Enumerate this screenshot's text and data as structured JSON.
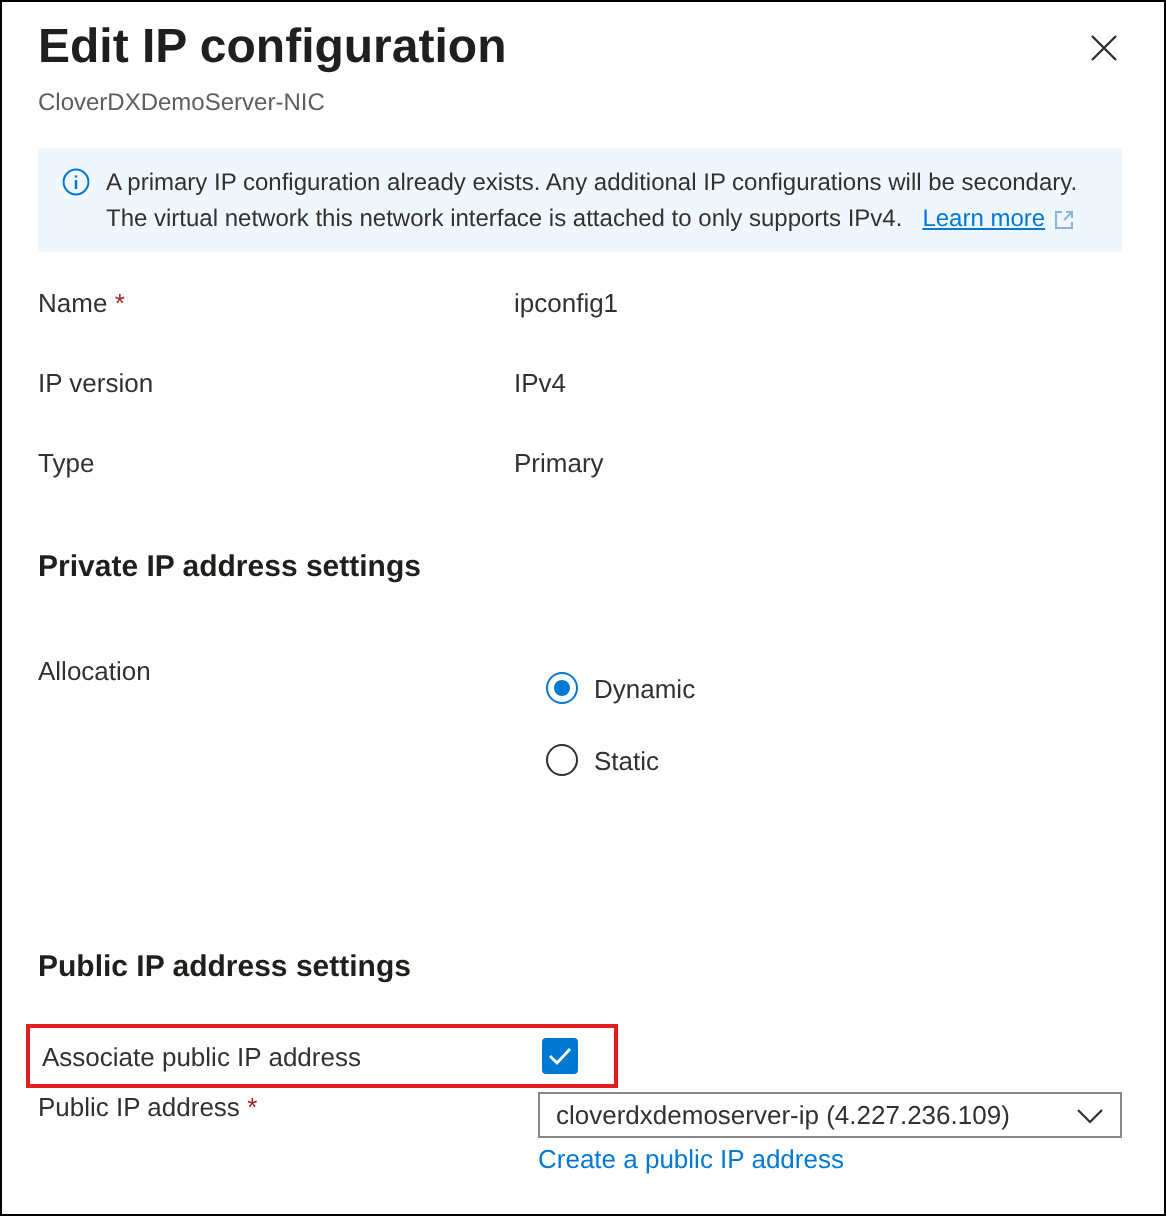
{
  "title": "Edit IP configuration",
  "subtitle": "CloverDXDemoServer-NIC",
  "info": {
    "lines": [
      "A primary IP configuration already exists. Any additional IP configurations will be secondary.",
      "The virtual network this network interface is attached to only supports IPv4."
    ],
    "link": "Learn more"
  },
  "fields": [
    {
      "label": "Name",
      "required_mark": "*",
      "value": "ipconfig1"
    },
    {
      "label": "IP version",
      "value": "IPv4"
    },
    {
      "label": "Type",
      "value": "Primary"
    }
  ],
  "private_section": {
    "heading": "Private IP address settings",
    "allocation_label": "Allocation",
    "options": [
      {
        "label": "Dynamic",
        "selected": true
      },
      {
        "label": "Static",
        "selected": false
      }
    ]
  },
  "public_section": {
    "heading": "Public IP address settings",
    "associate": {
      "label": "Associate public IP address",
      "checked": true,
      "highlighted": true
    },
    "address": {
      "label": "Public IP address",
      "required_mark": "*",
      "value": "cloverdxdemoserver-ip (4.227.236.109)",
      "link": "Create a public IP address"
    }
  }
}
